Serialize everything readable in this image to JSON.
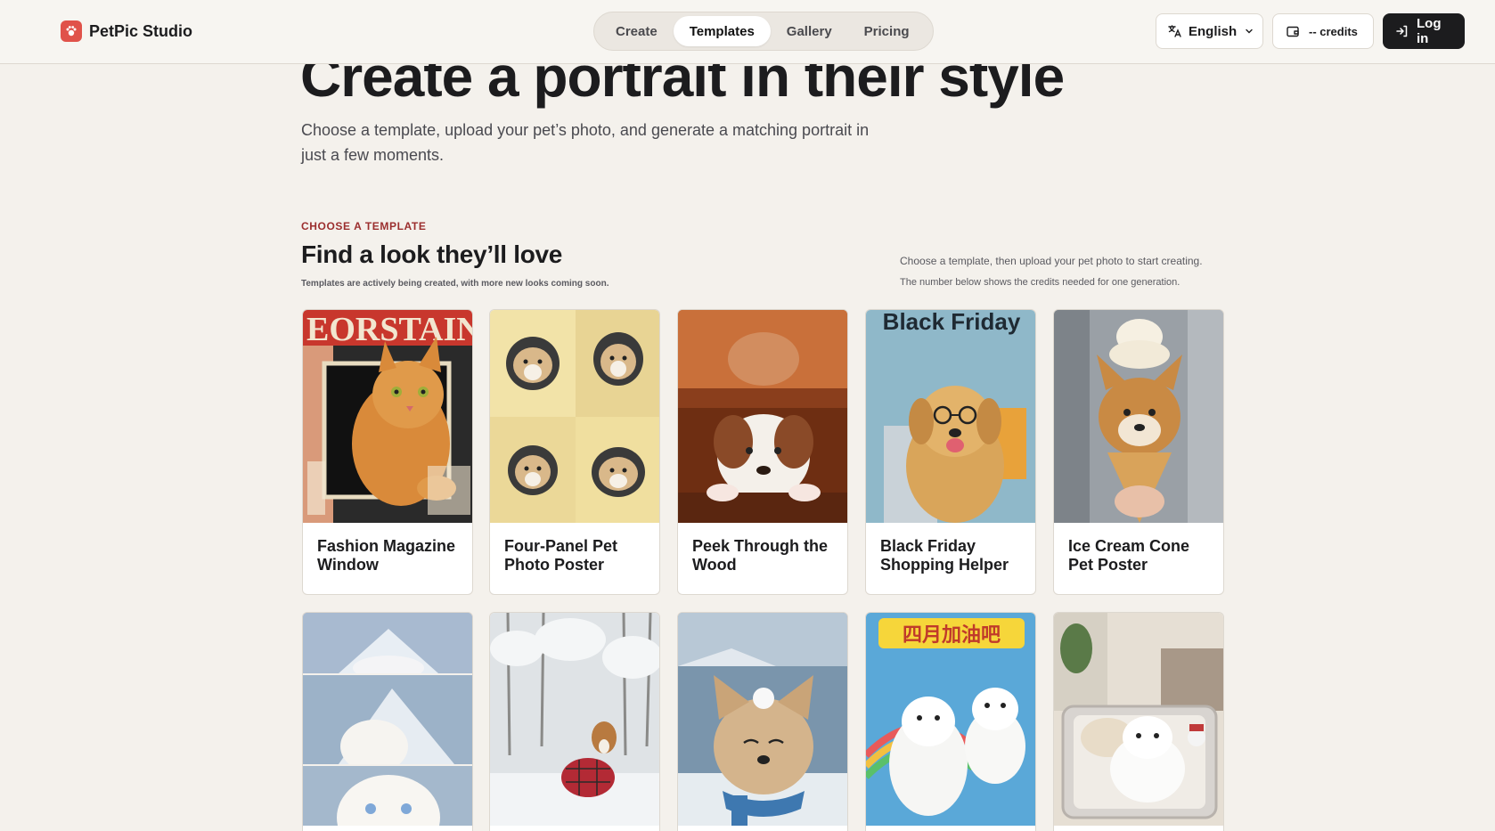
{
  "brand": {
    "name": "PetPic Studio",
    "icon": "paw-icon",
    "accent": "#e0524a"
  },
  "nav": {
    "tabs": [
      {
        "label": "Create",
        "active": false
      },
      {
        "label": "Templates",
        "active": true
      },
      {
        "label": "Gallery",
        "active": false
      },
      {
        "label": "Pricing",
        "active": false
      }
    ]
  },
  "header": {
    "language": {
      "label": "English",
      "icon": "translate-icon"
    },
    "credits": {
      "label": "-- credits",
      "icon": "wallet-icon"
    },
    "login": {
      "label": "Log in",
      "icon": "login-icon"
    }
  },
  "hero": {
    "title": "Create a portrait in their style",
    "subtitle": "Choose a template, upload your pet’s photo, and generate a matching portrait in just a few moments."
  },
  "section": {
    "eyebrow": "CHOOSE A TEMPLATE",
    "title": "Find a look they’ll love",
    "note": "Templates are actively being created, with more new looks coming soon.",
    "side_note_1": "Choose a template, then upload your pet photo to start creating.",
    "side_note_2": "The number below shows the credits needed for one generation."
  },
  "templates": [
    {
      "title": "Fashion Magazine Window",
      "image": "magazine-cat-image",
      "caption": "EORSTAINE"
    },
    {
      "title": "Four-Panel Pet Photo Poster",
      "image": "four-panel-dog-image"
    },
    {
      "title": "Peek Through the Wood",
      "image": "peek-dog-image"
    },
    {
      "title": "Black Friday Shopping Helper",
      "image": "black-friday-dog-image",
      "caption": "Black Friday"
    },
    {
      "title": "Ice Cream Cone Pet Poster",
      "image": "ice-cream-dog-image"
    },
    {
      "title": "",
      "image": "mountain-cat-image"
    },
    {
      "title": "",
      "image": "snow-dog-image"
    },
    {
      "title": "",
      "image": "scarf-dog-image"
    },
    {
      "title": "",
      "image": "colorful-poster-dog-image",
      "caption": "四月加油吧"
    },
    {
      "title": "",
      "image": "suitcase-dog-image"
    }
  ]
}
